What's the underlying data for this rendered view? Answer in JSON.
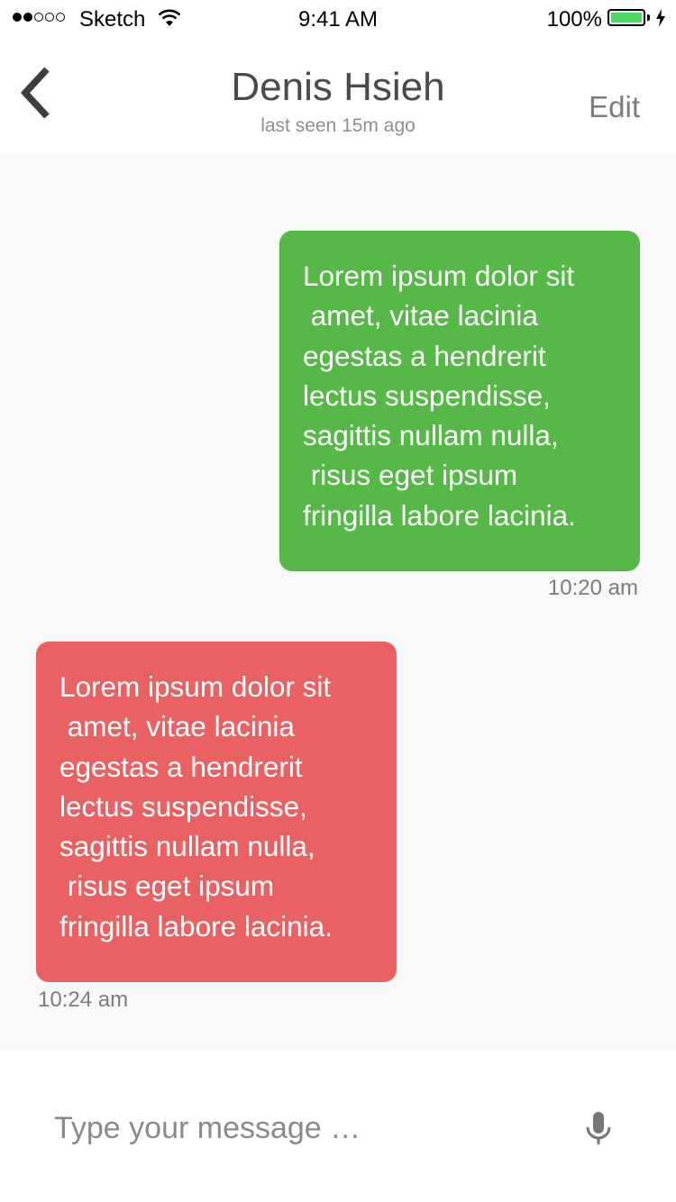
{
  "status_bar": {
    "carrier": "Sketch",
    "time": "9:41 AM",
    "battery_percent": "100%",
    "battery_level": 1.0,
    "signal_bars_filled": 2,
    "signal_bars_total": 5
  },
  "nav": {
    "title": "Denis Hsieh",
    "subtitle": "last seen 15m ago",
    "edit_label": "Edit",
    "back_icon": "chevron-left-icon"
  },
  "messages": [
    {
      "direction": "outgoing",
      "text": "Lorem ipsum dolor sit\n amet, vitae lacinia\negestas a hendrerit\nlectus suspendisse,\nsagittis nullam nulla,\n risus eget ipsum\nfringilla labore lacinia.",
      "time": "10:20 am",
      "color": "#56b847"
    },
    {
      "direction": "incoming",
      "text": "Lorem ipsum dolor sit\n amet, vitae lacinia\negestas a hendrerit\nlectus suspendisse,\nsagittis nullam nulla,\n risus eget ipsum\nfringilla labore lacinia.",
      "time": "10:24 am",
      "color": "#e96163"
    }
  ],
  "composer": {
    "placeholder": "Type your message …",
    "value": "",
    "mic_icon": "microphone-icon"
  },
  "colors": {
    "chat_background": "#f8f8f8",
    "battery_fill": "#4cd964"
  }
}
